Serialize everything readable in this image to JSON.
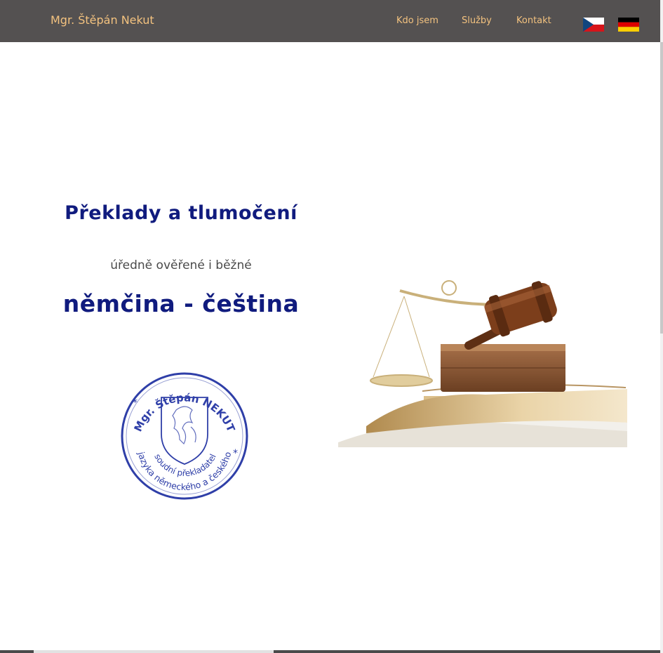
{
  "header": {
    "brand": "Mgr. Štěpán Nekut",
    "nav": [
      {
        "label": "Kdo jsem"
      },
      {
        "label": "Služby"
      },
      {
        "label": "Kontakt"
      }
    ],
    "flags": [
      {
        "name": "czech-flag-icon"
      },
      {
        "name": "german-flag-icon"
      }
    ]
  },
  "main": {
    "title": "Překlady a tlumočení",
    "subtitle": "úředně ověřené i běžné",
    "languages": "němčina - čeština",
    "stamp": {
      "top_text": "Mgr. Štěpán NEKUT",
      "line1": "soudní překladatel",
      "line2": "jazyka německého a českého"
    },
    "hero_image": "gavel-scales-books-image"
  },
  "colors": {
    "navbar": "#545151",
    "nav_text": "#f3c27f",
    "title": "#101b7e",
    "stamp": "#2f3fa8"
  }
}
